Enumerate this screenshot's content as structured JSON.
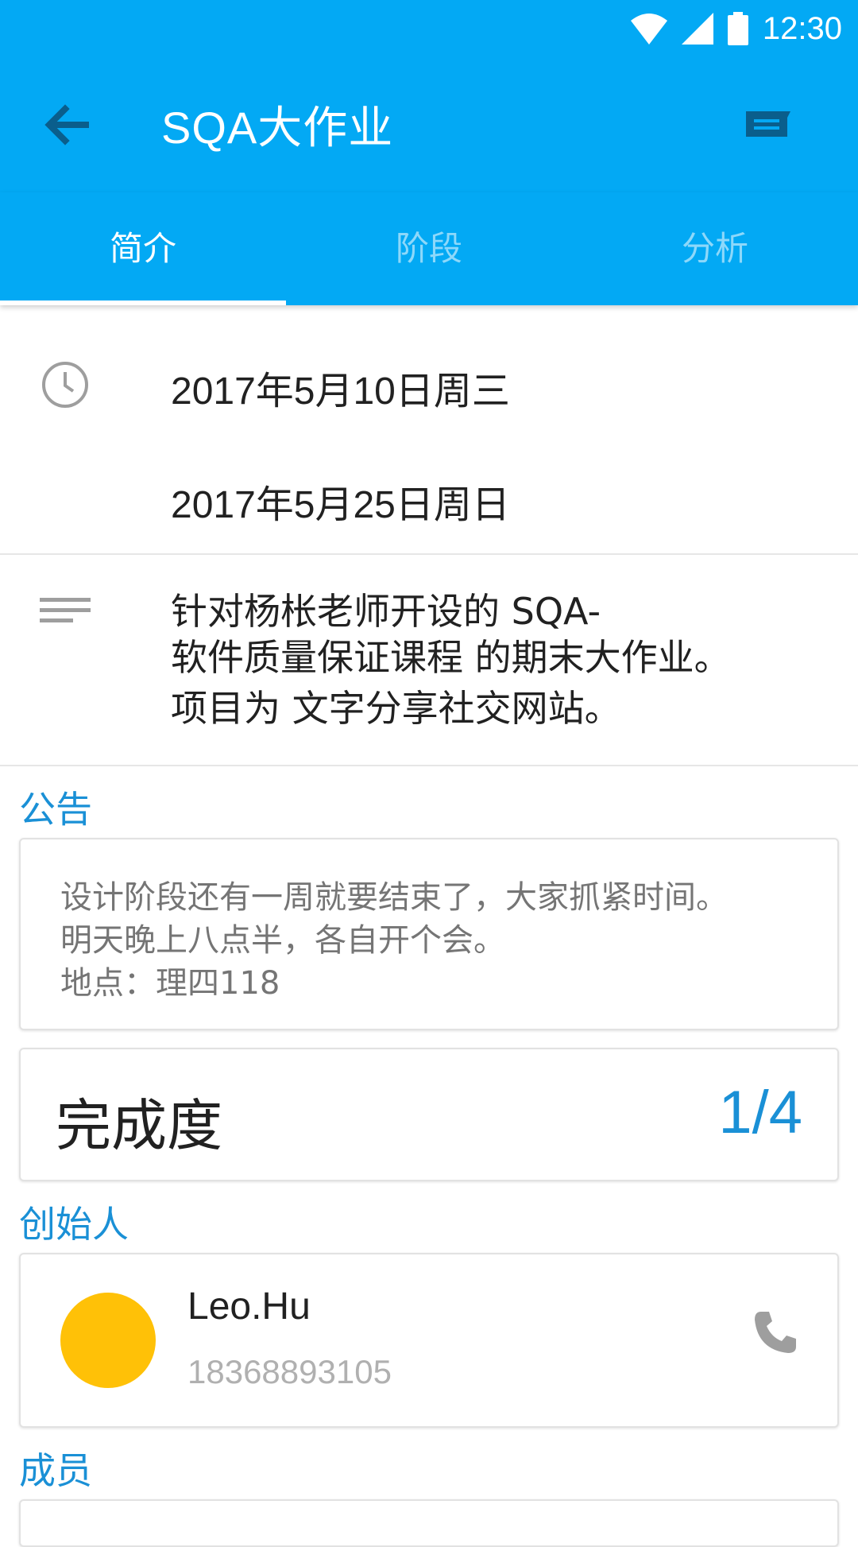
{
  "status_bar": {
    "time": "12:30"
  },
  "app_bar": {
    "title": "SQA大作业"
  },
  "tabs": [
    {
      "label": "简介",
      "active": true
    },
    {
      "label": "阶段",
      "active": false
    },
    {
      "label": "分析",
      "active": false
    }
  ],
  "dates": {
    "start": "2017年5月10日周三",
    "end": "2017年5月25日周日"
  },
  "description": {
    "line1": "针对杨枨老师开设的 SQA-",
    "line2": "软件质量保证课程 的期末大作业。",
    "line3": "项目为 文字分享社交网站。"
  },
  "announcement": {
    "section_label": "公告",
    "line1": "设计阶段还有一周就要结束了，大家抓紧时间。",
    "line2": "明天晚上八点半，各自开个会。",
    "line3": "地点：理四118"
  },
  "progress": {
    "label": "完成度",
    "value": "1/4"
  },
  "founder": {
    "section_label": "创始人",
    "name": "Leo.Hu",
    "phone": "18368893105",
    "avatar_color": "#ffc107"
  },
  "members": {
    "section_label": "成员"
  },
  "colors": {
    "primary": "#03a9f4",
    "accent_text": "#1a90d6"
  },
  "icons": {
    "back": "arrow-back-icon",
    "message": "message-icon",
    "clock": "clock-icon",
    "notes": "notes-icon",
    "phone": "phone-icon"
  }
}
